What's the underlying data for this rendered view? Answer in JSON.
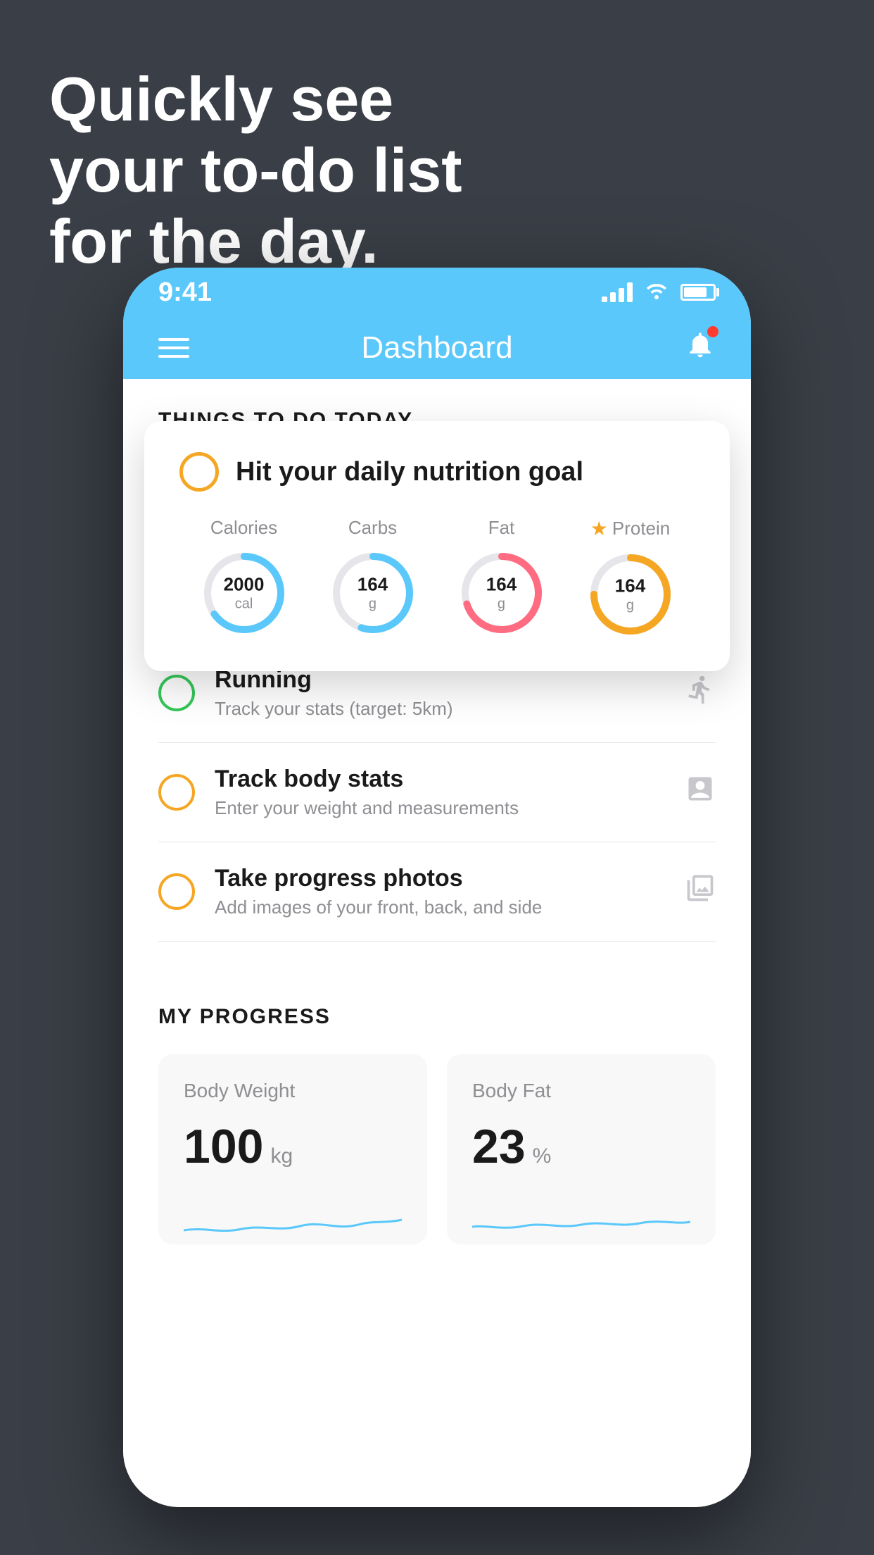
{
  "headline": {
    "line1": "Quickly see",
    "line2": "your to-do list",
    "line3": "for the day."
  },
  "phone": {
    "statusBar": {
      "time": "9:41"
    },
    "navBar": {
      "title": "Dashboard"
    },
    "thingsToDo": {
      "sectionTitle": "THINGS TO DO TODAY",
      "floatingCard": {
        "title": "Hit your daily nutrition goal",
        "nutrients": [
          {
            "label": "Calories",
            "value": "2000",
            "unit": "cal",
            "color": "#5ac8fa",
            "trackColor": "#e5e5ea",
            "percent": 65
          },
          {
            "label": "Carbs",
            "value": "164",
            "unit": "g",
            "color": "#5ac8fa",
            "trackColor": "#e5e5ea",
            "percent": 55
          },
          {
            "label": "Fat",
            "value": "164",
            "unit": "g",
            "color": "#ff6b81",
            "trackColor": "#e5e5ea",
            "percent": 70
          },
          {
            "label": "Protein",
            "value": "164",
            "unit": "g",
            "color": "#f5a623",
            "trackColor": "#e5e5ea",
            "percent": 75,
            "starred": true
          }
        ]
      },
      "items": [
        {
          "title": "Running",
          "subtitle": "Track your stats (target: 5km)",
          "circleColor": "green",
          "icon": "shoe"
        },
        {
          "title": "Track body stats",
          "subtitle": "Enter your weight and measurements",
          "circleColor": "yellow",
          "icon": "scale"
        },
        {
          "title": "Take progress photos",
          "subtitle": "Add images of your front, back, and side",
          "circleColor": "yellow",
          "icon": "person"
        }
      ]
    },
    "myProgress": {
      "sectionTitle": "MY PROGRESS",
      "cards": [
        {
          "title": "Body Weight",
          "value": "100",
          "unit": "kg"
        },
        {
          "title": "Body Fat",
          "value": "23",
          "unit": "%"
        }
      ]
    }
  }
}
